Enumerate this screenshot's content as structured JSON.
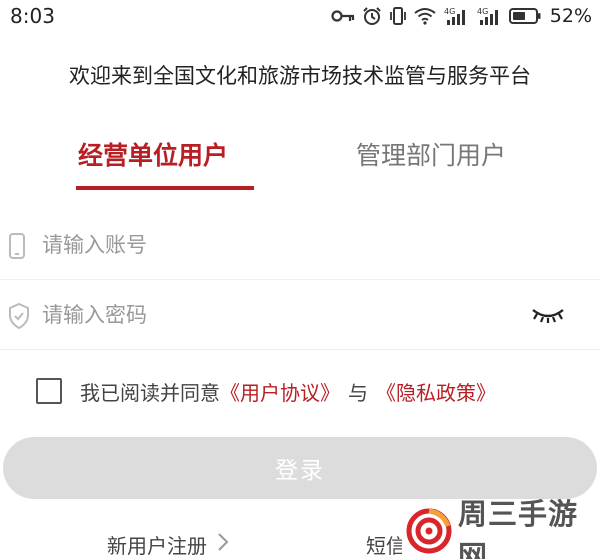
{
  "status_bar": {
    "time": "8:03",
    "battery": "52%",
    "icons": [
      "key-icon",
      "alarm-icon",
      "vibrate-icon",
      "wifi-icon",
      "signal-4g-icon",
      "signal-4g-icon",
      "battery-icon"
    ],
    "network_label": "4G"
  },
  "header": {
    "welcome": "欢迎来到全国文化和旅游市场技术监管与服务平台"
  },
  "tabs": [
    {
      "label": "经营单位用户",
      "active": true
    },
    {
      "label": "管理部门用户",
      "active": false
    }
  ],
  "form": {
    "account_placeholder": "请输入账号",
    "password_placeholder": "请输入密码",
    "agreement": {
      "prefix": "我已阅读并同意",
      "user_agreement": "《用户协议》",
      "connector": "与",
      "privacy_policy": "《隐私政策》",
      "checked": false
    },
    "login_label": "登录"
  },
  "footer": {
    "register_label": "新用户注册",
    "sms_label": "短信"
  },
  "watermark": {
    "text": "周三手游网"
  },
  "colors": {
    "accent": "#b81f24",
    "button_disabled": "#dcdcdc",
    "placeholder": "#999999"
  }
}
